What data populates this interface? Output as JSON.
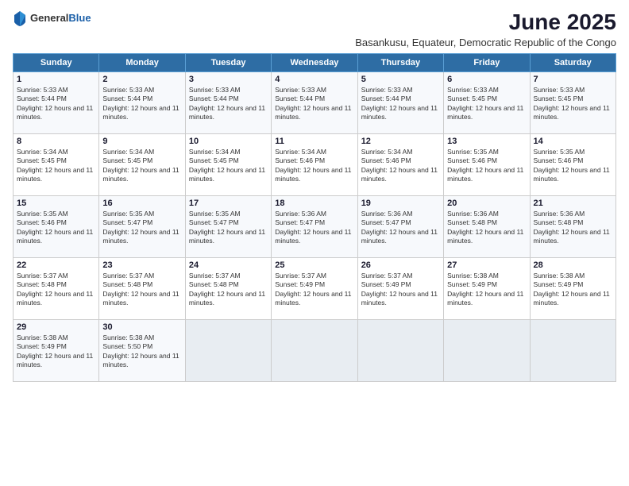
{
  "logo": {
    "general": "General",
    "blue": "Blue"
  },
  "title": "June 2025",
  "subtitle": "Basankusu, Equateur, Democratic Republic of the Congo",
  "header": {
    "accent_color": "#2e6da4"
  },
  "days_of_week": [
    "Sunday",
    "Monday",
    "Tuesday",
    "Wednesday",
    "Thursday",
    "Friday",
    "Saturday"
  ],
  "weeks": [
    [
      {
        "num": "1",
        "sunrise": "5:33 AM",
        "sunset": "5:44 PM",
        "daylight": "12 hours and 11 minutes."
      },
      {
        "num": "2",
        "sunrise": "5:33 AM",
        "sunset": "5:44 PM",
        "daylight": "12 hours and 11 minutes."
      },
      {
        "num": "3",
        "sunrise": "5:33 AM",
        "sunset": "5:44 PM",
        "daylight": "12 hours and 11 minutes."
      },
      {
        "num": "4",
        "sunrise": "5:33 AM",
        "sunset": "5:44 PM",
        "daylight": "12 hours and 11 minutes."
      },
      {
        "num": "5",
        "sunrise": "5:33 AM",
        "sunset": "5:44 PM",
        "daylight": "12 hours and 11 minutes."
      },
      {
        "num": "6",
        "sunrise": "5:33 AM",
        "sunset": "5:45 PM",
        "daylight": "12 hours and 11 minutes."
      },
      {
        "num": "7",
        "sunrise": "5:33 AM",
        "sunset": "5:45 PM",
        "daylight": "12 hours and 11 minutes."
      }
    ],
    [
      {
        "num": "8",
        "sunrise": "5:34 AM",
        "sunset": "5:45 PM",
        "daylight": "12 hours and 11 minutes."
      },
      {
        "num": "9",
        "sunrise": "5:34 AM",
        "sunset": "5:45 PM",
        "daylight": "12 hours and 11 minutes."
      },
      {
        "num": "10",
        "sunrise": "5:34 AM",
        "sunset": "5:45 PM",
        "daylight": "12 hours and 11 minutes."
      },
      {
        "num": "11",
        "sunrise": "5:34 AM",
        "sunset": "5:46 PM",
        "daylight": "12 hours and 11 minutes."
      },
      {
        "num": "12",
        "sunrise": "5:34 AM",
        "sunset": "5:46 PM",
        "daylight": "12 hours and 11 minutes."
      },
      {
        "num": "13",
        "sunrise": "5:35 AM",
        "sunset": "5:46 PM",
        "daylight": "12 hours and 11 minutes."
      },
      {
        "num": "14",
        "sunrise": "5:35 AM",
        "sunset": "5:46 PM",
        "daylight": "12 hours and 11 minutes."
      }
    ],
    [
      {
        "num": "15",
        "sunrise": "5:35 AM",
        "sunset": "5:46 PM",
        "daylight": "12 hours and 11 minutes."
      },
      {
        "num": "16",
        "sunrise": "5:35 AM",
        "sunset": "5:47 PM",
        "daylight": "12 hours and 11 minutes."
      },
      {
        "num": "17",
        "sunrise": "5:35 AM",
        "sunset": "5:47 PM",
        "daylight": "12 hours and 11 minutes."
      },
      {
        "num": "18",
        "sunrise": "5:36 AM",
        "sunset": "5:47 PM",
        "daylight": "12 hours and 11 minutes."
      },
      {
        "num": "19",
        "sunrise": "5:36 AM",
        "sunset": "5:47 PM",
        "daylight": "12 hours and 11 minutes."
      },
      {
        "num": "20",
        "sunrise": "5:36 AM",
        "sunset": "5:48 PM",
        "daylight": "12 hours and 11 minutes."
      },
      {
        "num": "21",
        "sunrise": "5:36 AM",
        "sunset": "5:48 PM",
        "daylight": "12 hours and 11 minutes."
      }
    ],
    [
      {
        "num": "22",
        "sunrise": "5:37 AM",
        "sunset": "5:48 PM",
        "daylight": "12 hours and 11 minutes."
      },
      {
        "num": "23",
        "sunrise": "5:37 AM",
        "sunset": "5:48 PM",
        "daylight": "12 hours and 11 minutes."
      },
      {
        "num": "24",
        "sunrise": "5:37 AM",
        "sunset": "5:48 PM",
        "daylight": "12 hours and 11 minutes."
      },
      {
        "num": "25",
        "sunrise": "5:37 AM",
        "sunset": "5:49 PM",
        "daylight": "12 hours and 11 minutes."
      },
      {
        "num": "26",
        "sunrise": "5:37 AM",
        "sunset": "5:49 PM",
        "daylight": "12 hours and 11 minutes."
      },
      {
        "num": "27",
        "sunrise": "5:38 AM",
        "sunset": "5:49 PM",
        "daylight": "12 hours and 11 minutes."
      },
      {
        "num": "28",
        "sunrise": "5:38 AM",
        "sunset": "5:49 PM",
        "daylight": "12 hours and 11 minutes."
      }
    ],
    [
      {
        "num": "29",
        "sunrise": "5:38 AM",
        "sunset": "5:49 PM",
        "daylight": "12 hours and 11 minutes."
      },
      {
        "num": "30",
        "sunrise": "5:38 AM",
        "sunset": "5:50 PM",
        "daylight": "12 hours and 11 minutes."
      },
      null,
      null,
      null,
      null,
      null
    ]
  ]
}
